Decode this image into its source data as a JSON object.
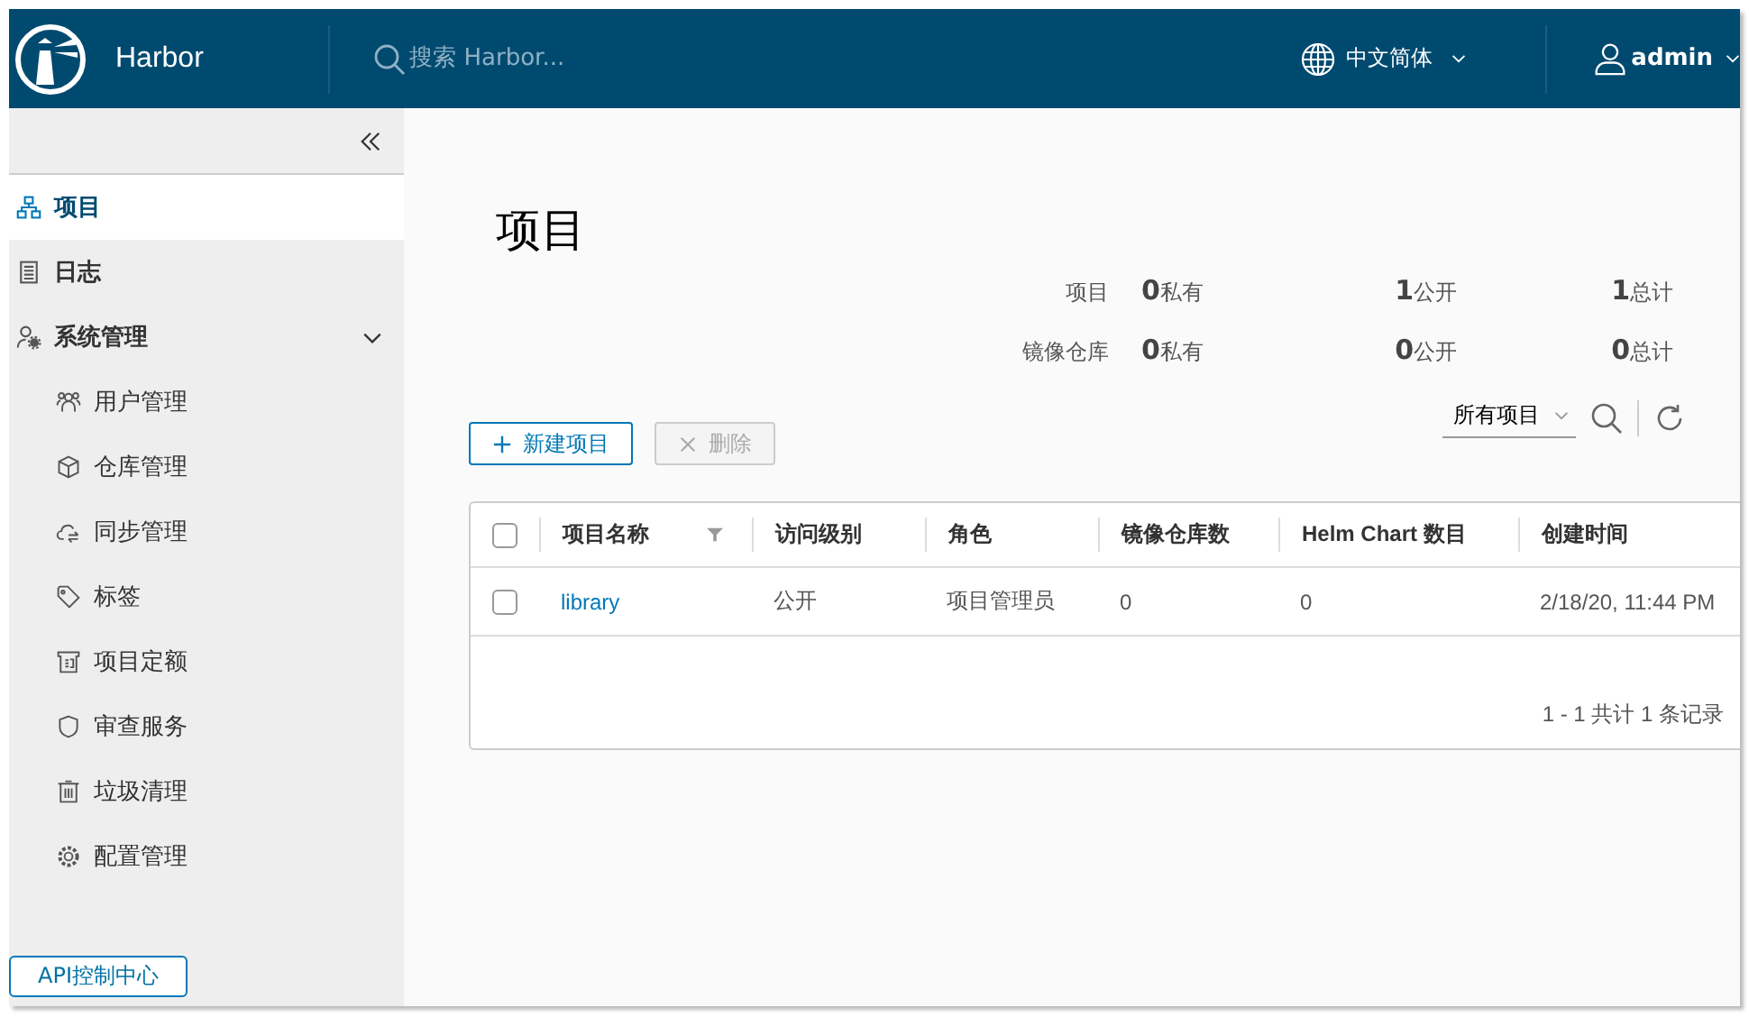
{
  "header": {
    "brand": "Harbor",
    "search": {
      "placeholder": "搜索 Harbor..."
    },
    "language": "中文简体",
    "user": "admin"
  },
  "sidebar": {
    "items": [
      {
        "label": "项目",
        "selected": true
      },
      {
        "label": "日志",
        "selected": false
      },
      {
        "label": "系统管理",
        "selected": false,
        "expanded": true,
        "children": [
          {
            "label": "用户管理",
            "selected": false
          },
          {
            "label": "仓库管理",
            "selected": false
          },
          {
            "label": "同步管理",
            "selected": false
          },
          {
            "label": "标签",
            "selected": false
          },
          {
            "label": "项目定额",
            "selected": false
          },
          {
            "label": "审查服务",
            "selected": false
          },
          {
            "label": "垃圾清理",
            "selected": false
          },
          {
            "label": "配置管理",
            "selected": false
          }
        ]
      }
    ],
    "api_button": "API控制中心"
  },
  "page": {
    "title": "项目",
    "stats": [
      {
        "label": "项目",
        "values": [
          {
            "value": "0",
            "unit": "私有"
          },
          {
            "value": "1",
            "unit": "公开"
          },
          {
            "value": "1",
            "unit": "总计"
          }
        ]
      },
      {
        "label": "镜像仓库",
        "values": [
          {
            "value": "0",
            "unit": "私有"
          },
          {
            "value": "0",
            "unit": "公开"
          },
          {
            "value": "0",
            "unit": "总计"
          }
        ]
      }
    ],
    "buttons": [
      {
        "label": "新建项目",
        "disabled": false
      },
      {
        "label": "删除",
        "disabled": true
      }
    ],
    "filter": {
      "value": "所有项目"
    },
    "table": {
      "select_all": {
        "checked": false
      },
      "columns": [
        {
          "label": "项目名称",
          "filter": true
        },
        {
          "label": "访问级别",
          "filter": false
        },
        {
          "label": "角色",
          "filter": false
        },
        {
          "label": "镜像仓库数",
          "filter": false
        },
        {
          "label": "Helm Chart 数目",
          "filter": false
        },
        {
          "label": "创建时间",
          "filter": false
        }
      ],
      "rows": [
        {
          "checked": false,
          "cells": [
            "library",
            "公开",
            "项目管理员",
            "0",
            "0",
            "2/18/20, 11:44 PM"
          ]
        }
      ],
      "footer": "1 - 1 共计 1 条记录"
    }
  }
}
